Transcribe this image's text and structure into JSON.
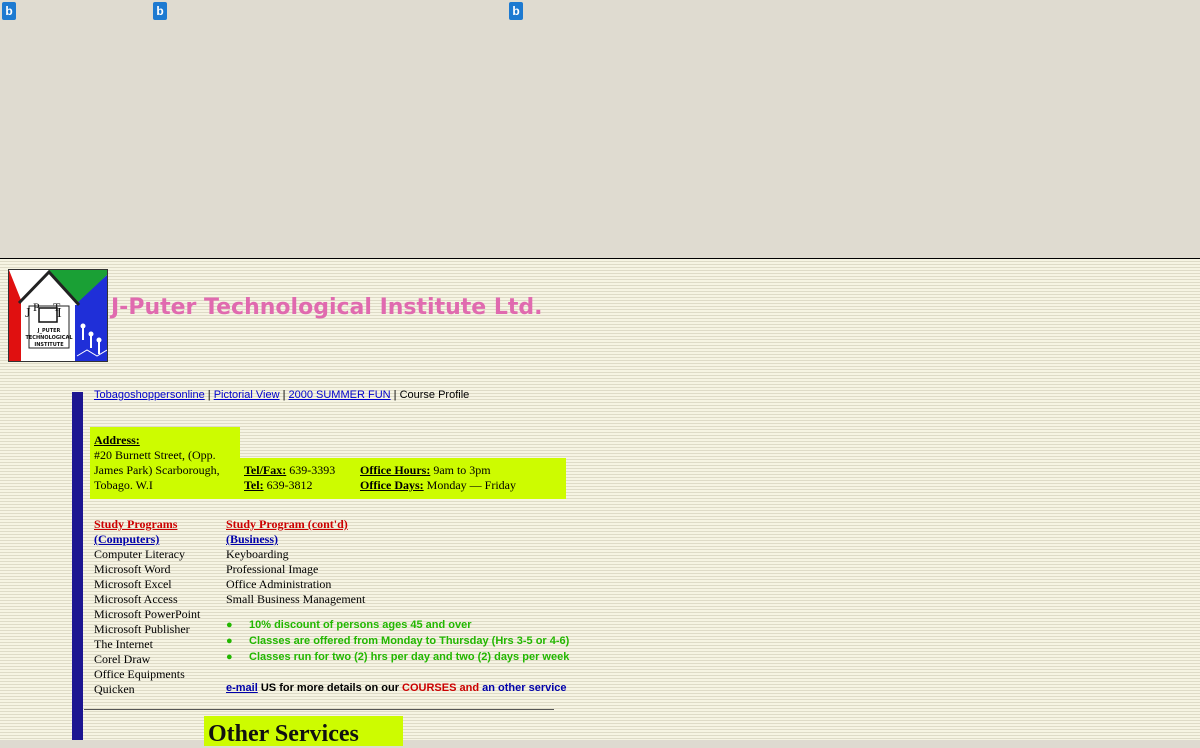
{
  "topbar": {
    "icons": [
      "b-icon",
      "b-icon",
      "b-icon"
    ],
    "icon_glyph": "b"
  },
  "logo": {
    "text_line1": "J_PUTER",
    "text_line2": "TECHNOLOGICAL",
    "text_line3": "INSTITUTE"
  },
  "site_title": "J-Puter Technological Institute Ltd.",
  "nav": {
    "links": [
      "Tobagoshoppersonline",
      "Pictorial View",
      "2000 SUMMER FUN"
    ],
    "current": "Course Profile",
    "separator": " | "
  },
  "address": {
    "label": "Address:",
    "lines": [
      "#20 Burnett Street, (Opp.",
      "James Park) Scarborough,",
      "Tobago. W.I"
    ]
  },
  "contact": {
    "telfax_label": "Tel/Fax:",
    "telfax_value": " 639-3393",
    "tel_label": "Tel:",
    "tel_value": " 639-3812",
    "hours_label": "Office Hours:",
    "hours_value": " 9am to 3pm",
    "days_label": "Office Days:",
    "days_value": " Monday — Friday"
  },
  "programs": {
    "computers": {
      "title": "Study Programs",
      "subtitle": "(Computers)",
      "items": [
        "Computer Literacy",
        "Microsoft Word",
        "Microsoft Excel",
        "Microsoft Access",
        "Microsoft PowerPoint",
        "Microsoft Publisher",
        "The Internet",
        "Corel Draw",
        "Office Equipments",
        "Quicken"
      ]
    },
    "business": {
      "title": "Study Program (cont'd)",
      "subtitle": "(Business)",
      "items": [
        "Keyboarding",
        "Professional Image",
        "Office Administration",
        "Small Business Management"
      ]
    }
  },
  "bullets": {
    "glyph": "●",
    "items": [
      "10% discount of persons ages 45 and over",
      "Classes are offered from Monday to Thursday (Hrs 3-5 or 4-6)",
      "Classes run for two (2) hrs per day and two (2) days per week"
    ]
  },
  "email_line": {
    "link": "e-mail",
    "part1": " US for more details on our ",
    "courses": "COURSES",
    "and": " and",
    "other": " an other service"
  },
  "other_services_title": "Other Services",
  "colors": {
    "title_pink": "#e06aaf",
    "highlight": "#cdfc00",
    "bar_blue": "#1d1691",
    "bullet_green": "#22b700"
  }
}
